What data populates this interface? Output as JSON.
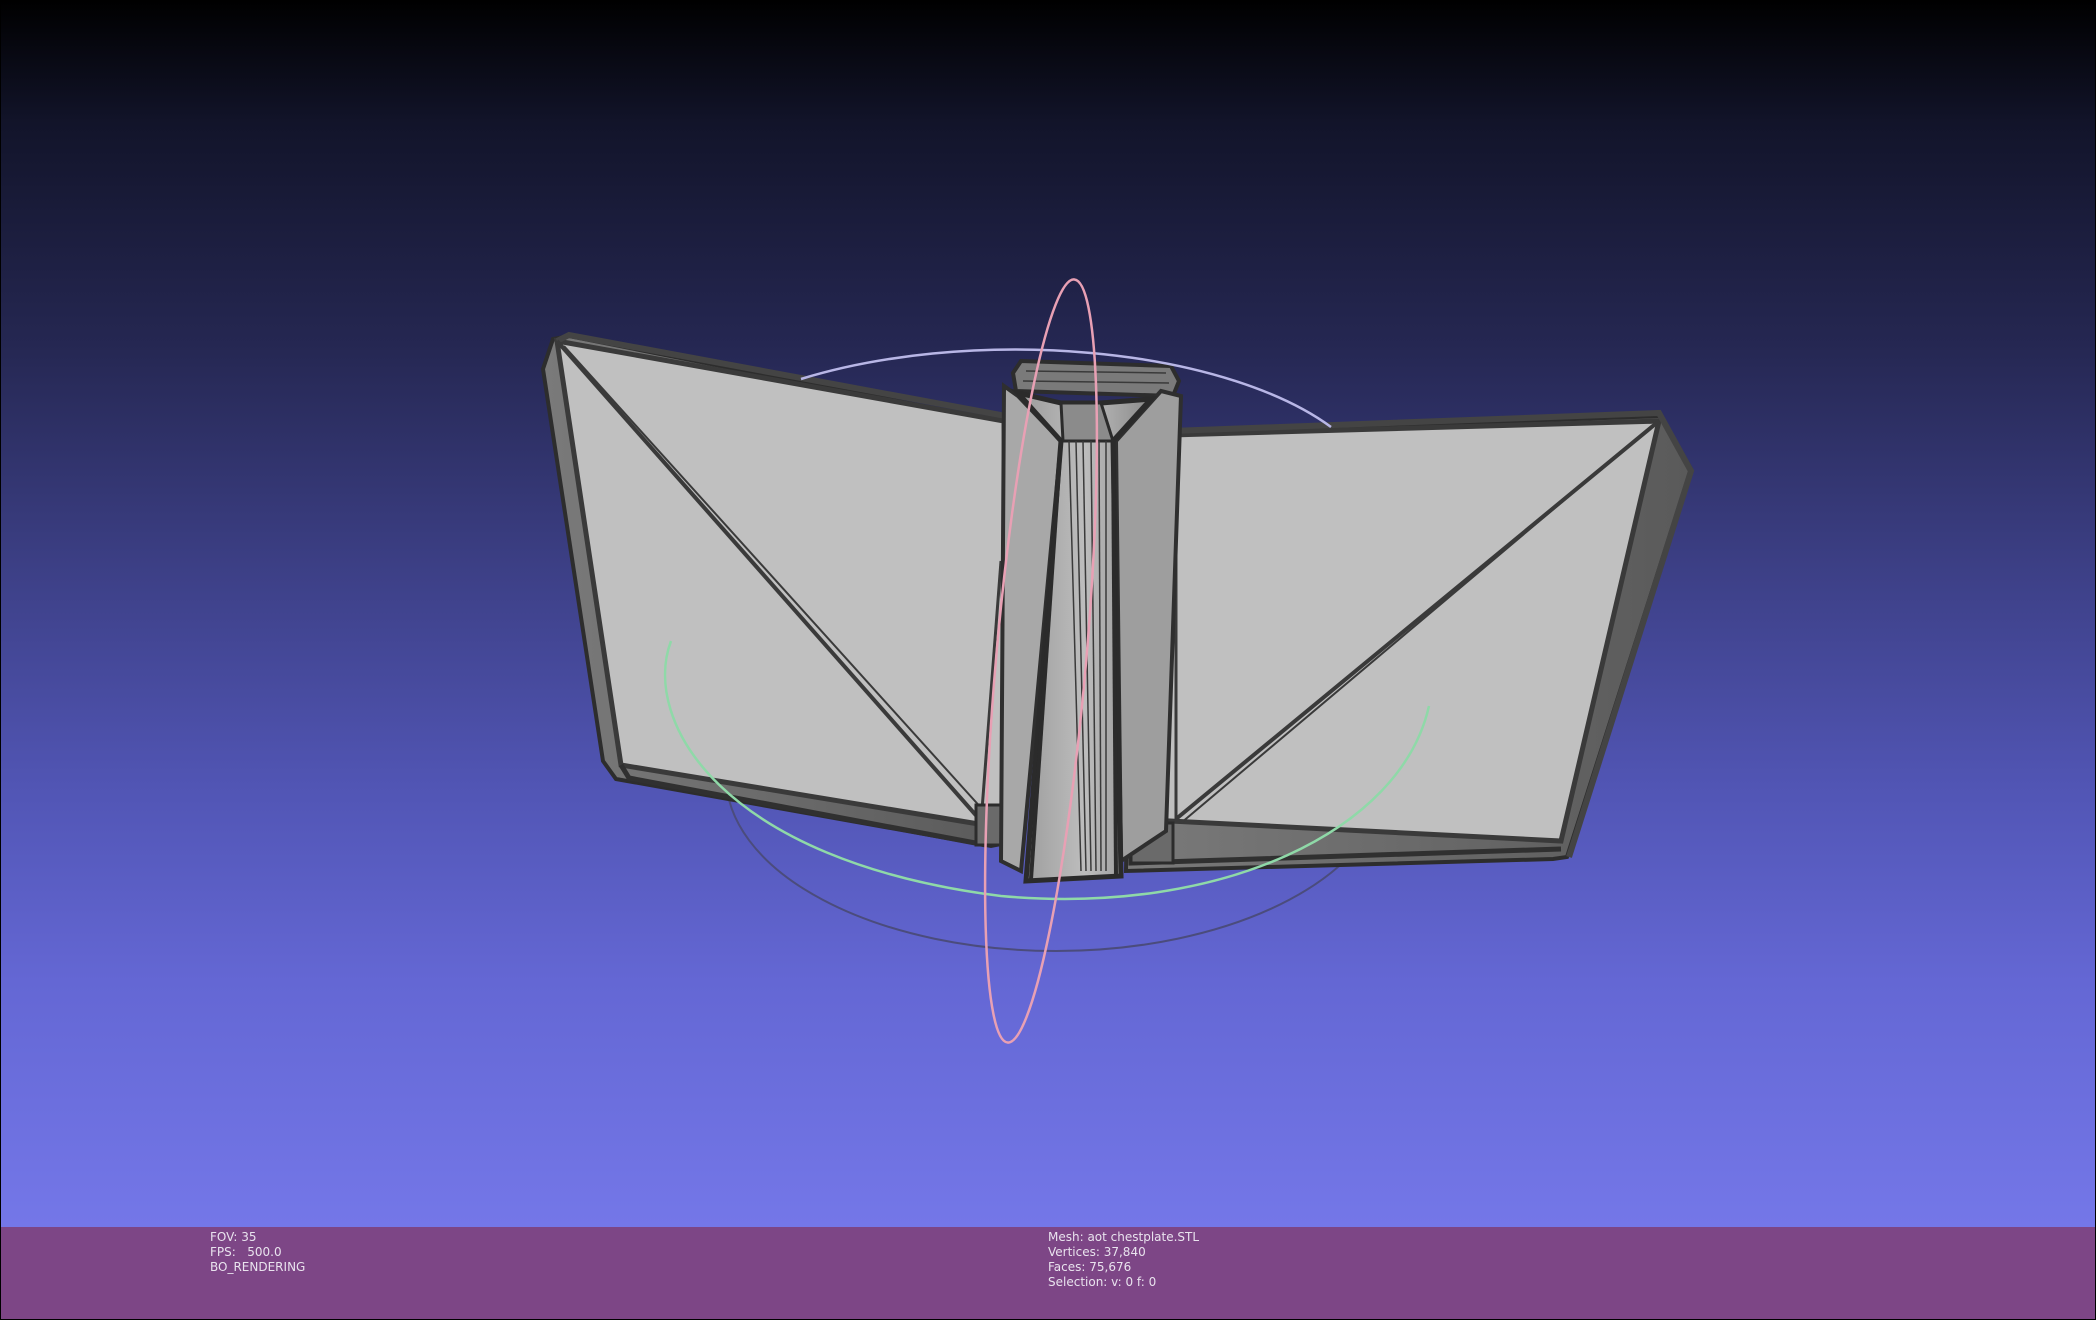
{
  "viewer": {
    "left_info": {
      "fov": "FOV: 35",
      "fps": "FPS:   500.0",
      "mode": "BO_RENDERING"
    },
    "mesh_info": {
      "mesh": "Mesh: aot chestplate.STL",
      "vertices": "Vertices: 37,840",
      "faces": "Faces: 75,676",
      "selection": "Selection: v: 0 f: 0"
    }
  },
  "colors": {
    "info_bar": "#7d4686",
    "mesh_face": "#c0c0c0",
    "mesh_edge": "#3a3a3a",
    "trackball_x": "#e8a0b4",
    "trackball_y": "#b8b6e6",
    "trackball_z": "#8fd9a8"
  },
  "icons": {
    "trackball": "trackball-gizmo"
  }
}
